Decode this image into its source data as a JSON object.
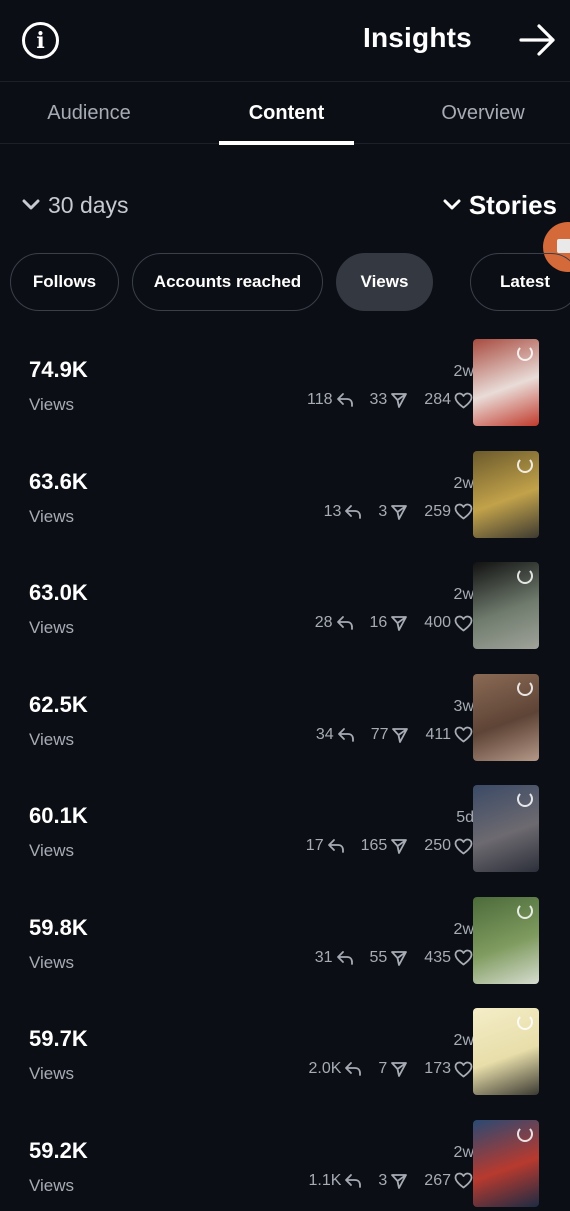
{
  "header": {
    "title": "Insights",
    "info_icon": "info-icon",
    "next_icon": "arrow-right-icon"
  },
  "tabs": [
    {
      "label": "Audience",
      "active": false
    },
    {
      "label": "Content",
      "active": true
    },
    {
      "label": "Overview",
      "active": false
    }
  ],
  "filters": {
    "range": "30 days",
    "type": "Stories"
  },
  "sort_pills": [
    {
      "label": "Follows",
      "selected": false
    },
    {
      "label": "Accounts reached",
      "selected": false
    },
    {
      "label": "Views",
      "selected": true
    },
    {
      "label": "Latest",
      "selected": false
    }
  ],
  "stories": [
    {
      "value": "74.9K",
      "label": "Views",
      "age": "2w",
      "replies": "118",
      "shares": "33",
      "likes": "284",
      "thumb_colors": [
        "#a84b3f",
        "#e9dcd8",
        "#c13a2c"
      ]
    },
    {
      "value": "63.6K",
      "label": "Views",
      "age": "2w",
      "replies": "13",
      "shares": "3",
      "likes": "259",
      "thumb_colors": [
        "#6b5a2c",
        "#c2a24a",
        "#3d3a31"
      ]
    },
    {
      "value": "63.0K",
      "label": "Views",
      "age": "2w",
      "replies": "28",
      "shares": "16",
      "likes": "400",
      "thumb_colors": [
        "#111111",
        "#6f7b6d",
        "#a0a39a"
      ]
    },
    {
      "value": "62.5K",
      "label": "Views",
      "age": "3w",
      "replies": "34",
      "shares": "77",
      "likes": "411",
      "thumb_colors": [
        "#8a6a55",
        "#5e4436",
        "#b49888"
      ]
    },
    {
      "value": "60.1K",
      "label": "Views",
      "age": "5d",
      "replies": "17",
      "shares": "165",
      "likes": "250",
      "thumb_colors": [
        "#3b4a66",
        "#6d6a70",
        "#2c2f3a"
      ]
    },
    {
      "value": "59.8K",
      "label": "Views",
      "age": "2w",
      "replies": "31",
      "shares": "55",
      "likes": "435",
      "thumb_colors": [
        "#4b6b3a",
        "#7f9b5f",
        "#d6dccf"
      ]
    },
    {
      "value": "59.7K",
      "label": "Views",
      "age": "2w",
      "replies": "2.0K",
      "shares": "7",
      "likes": "173",
      "thumb_colors": [
        "#f4edc7",
        "#e8deaa",
        "#3b3a32"
      ]
    },
    {
      "value": "59.2K",
      "label": "Views",
      "age": "2w",
      "replies": "1.1K",
      "shares": "3",
      "likes": "267",
      "thumb_colors": [
        "#2a4a73",
        "#b83a2e",
        "#1c2b44"
      ]
    }
  ]
}
